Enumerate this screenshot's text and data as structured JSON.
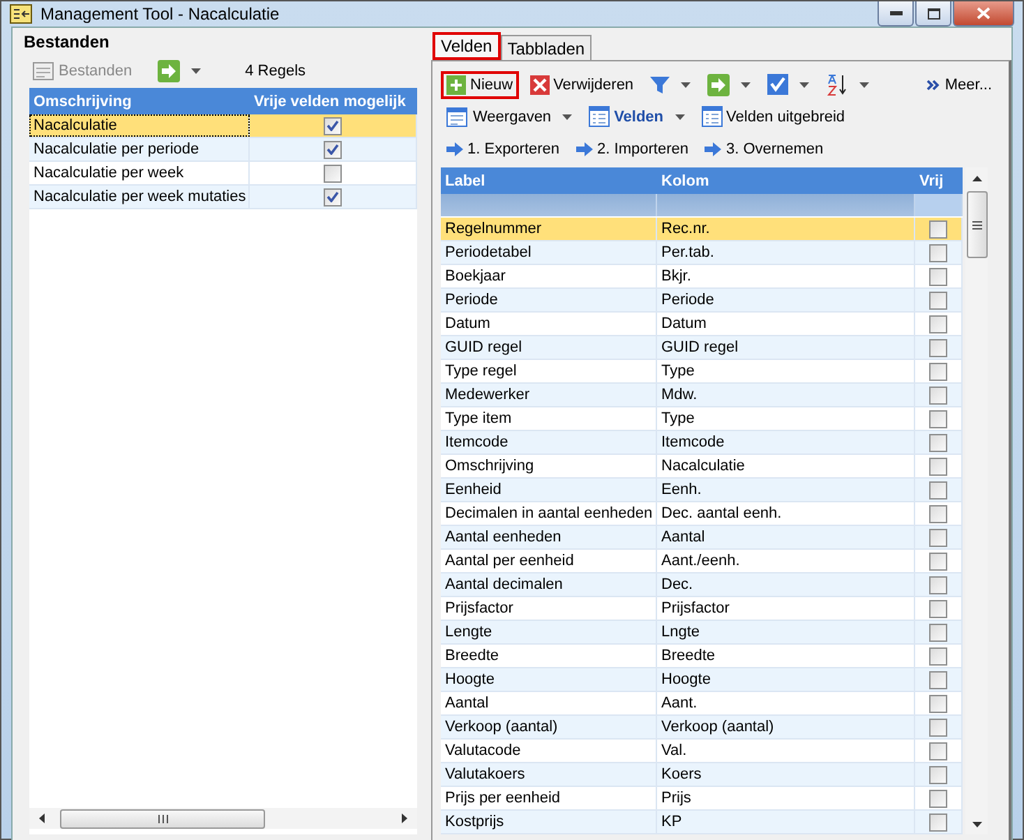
{
  "window": {
    "title": "Management Tool - Nacalculatie"
  },
  "left": {
    "title": "Bestanden",
    "toolbar": {
      "button": "Bestanden",
      "count": "4 Regels"
    },
    "columns": [
      "Omschrijving",
      "Vrije velden mogelijk"
    ],
    "rows": [
      {
        "name": "Nacalculatie",
        "checked": true,
        "selected": true
      },
      {
        "name": "Nacalculatie per periode",
        "checked": true,
        "selected": false
      },
      {
        "name": "Nacalculatie per week",
        "checked": false,
        "selected": false
      },
      {
        "name": "Nacalculatie per week mutaties",
        "checked": true,
        "selected": false
      }
    ]
  },
  "tabs": [
    {
      "label": "Velden",
      "selected": true,
      "highlighted": true
    },
    {
      "label": "Tabbladen",
      "selected": false,
      "highlighted": false
    }
  ],
  "toolbar_rows": [
    [
      {
        "kind": "new",
        "label": "Nieuw",
        "dropdown": false,
        "highlighted": true
      },
      {
        "kind": "delete",
        "label": "Verwijderen",
        "dropdown": false,
        "highlighted": false
      },
      {
        "kind": "filter",
        "dropdown": true,
        "highlighted": false
      },
      {
        "kind": "arrow",
        "dropdown": true,
        "highlighted": false
      },
      {
        "kind": "check",
        "dropdown": true,
        "highlighted": false
      },
      {
        "kind": "sort",
        "dropdown": true,
        "highlighted": false
      },
      {
        "kind": "more",
        "label": "Meer...",
        "dropdown": false,
        "highlighted": false
      }
    ],
    [
      {
        "kind": "views",
        "label": "Weergaven",
        "dropdown": true,
        "highlighted": false
      },
      {
        "kind": "fields",
        "label": "Velden",
        "dropdown": true,
        "bold": true,
        "highlighted": false
      },
      {
        "kind": "fields",
        "label": "Velden uitgebreid",
        "dropdown": false,
        "highlighted": false
      }
    ],
    [
      {
        "kind": "step",
        "label": "1. Exporteren",
        "dropdown": false,
        "highlighted": false
      },
      {
        "kind": "step",
        "label": "2. Importeren",
        "dropdown": false,
        "highlighted": false
      },
      {
        "kind": "step",
        "label": "3. Overnemen",
        "dropdown": false,
        "highlighted": false
      }
    ]
  ],
  "grid": {
    "columns": [
      "Label",
      "Kolom",
      "Vrij"
    ],
    "rows": [
      {
        "label": "Regelnummer",
        "kolom": "Rec.nr.",
        "checked": false,
        "selected": true
      },
      {
        "label": "Periodetabel",
        "kolom": "Per.tab.",
        "checked": false,
        "selected": false
      },
      {
        "label": "Boekjaar",
        "kolom": "Bkjr.",
        "checked": false,
        "selected": false
      },
      {
        "label": "Periode",
        "kolom": "Periode",
        "checked": false,
        "selected": false
      },
      {
        "label": "Datum",
        "kolom": "Datum",
        "checked": false,
        "selected": false
      },
      {
        "label": "GUID regel",
        "kolom": "GUID regel",
        "checked": false,
        "selected": false
      },
      {
        "label": "Type regel",
        "kolom": "Type",
        "checked": false,
        "selected": false
      },
      {
        "label": "Medewerker",
        "kolom": "Mdw.",
        "checked": false,
        "selected": false
      },
      {
        "label": "Type item",
        "kolom": "Type",
        "checked": false,
        "selected": false
      },
      {
        "label": "Itemcode",
        "kolom": "Itemcode",
        "checked": false,
        "selected": false
      },
      {
        "label": "Omschrijving",
        "kolom": "Nacalculatie",
        "checked": false,
        "selected": false
      },
      {
        "label": "Eenheid",
        "kolom": "Eenh.",
        "checked": false,
        "selected": false
      },
      {
        "label": "Decimalen in aantal eenheden",
        "kolom": "Dec. aantal eenh.",
        "checked": false,
        "selected": false
      },
      {
        "label": "Aantal eenheden",
        "kolom": "Aantal",
        "checked": false,
        "selected": false
      },
      {
        "label": "Aantal per eenheid",
        "kolom": "Aant./eenh.",
        "checked": false,
        "selected": false
      },
      {
        "label": "Aantal decimalen",
        "kolom": "Dec.",
        "checked": false,
        "selected": false
      },
      {
        "label": "Prijsfactor",
        "kolom": "Prijsfactor",
        "checked": false,
        "selected": false
      },
      {
        "label": "Lengte",
        "kolom": "Lngte",
        "checked": false,
        "selected": false
      },
      {
        "label": "Breedte",
        "kolom": "Breedte",
        "checked": false,
        "selected": false
      },
      {
        "label": "Hoogte",
        "kolom": "Hoogte",
        "checked": false,
        "selected": false
      },
      {
        "label": "Aantal",
        "kolom": "Aant.",
        "checked": false,
        "selected": false
      },
      {
        "label": "Verkoop (aantal)",
        "kolom": "Verkoop (aantal)",
        "checked": false,
        "selected": false
      },
      {
        "label": "Valutacode",
        "kolom": "Val.",
        "checked": false,
        "selected": false
      },
      {
        "label": "Valutakoers",
        "kolom": "Koers",
        "checked": false,
        "selected": false
      },
      {
        "label": "Prijs per eenheid",
        "kolom": "Prijs",
        "checked": false,
        "selected": false
      },
      {
        "label": "Kostprijs",
        "kolom": "KP",
        "checked": false,
        "selected": false
      }
    ]
  }
}
